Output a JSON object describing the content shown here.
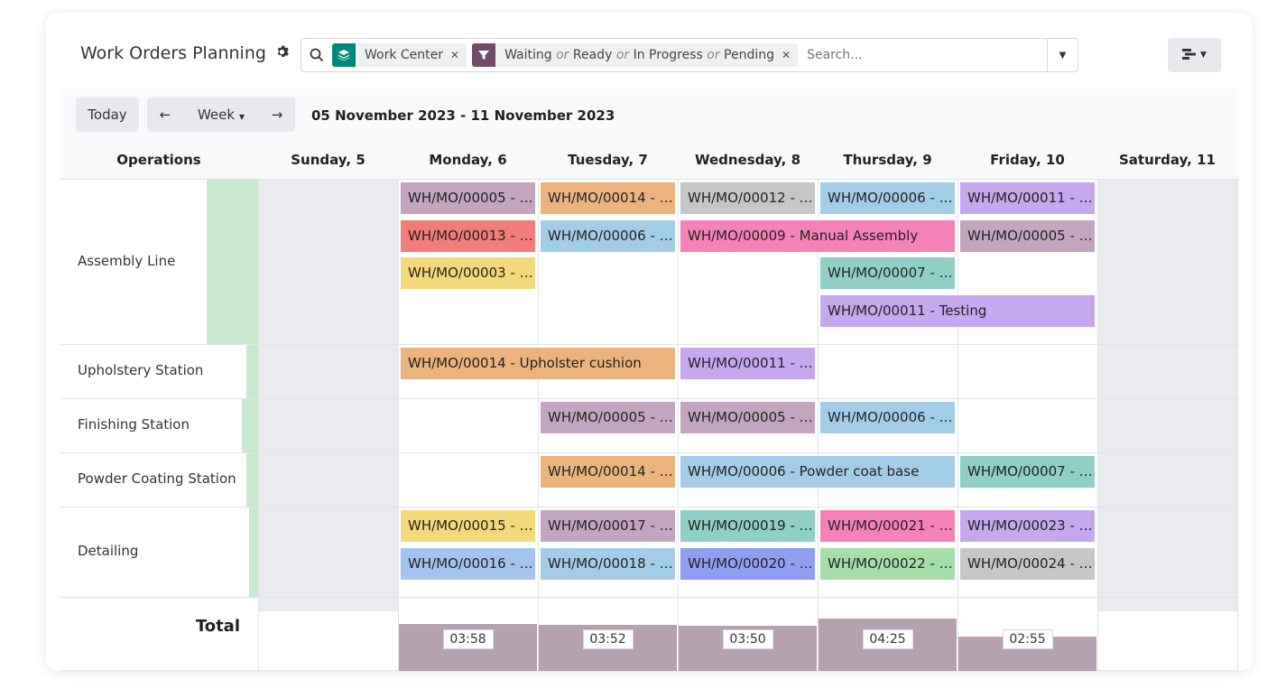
{
  "header": {
    "title": "Work Orders Planning",
    "facets": [
      {
        "icon": "layers-icon",
        "icon_color": "#00897b",
        "text_html": "Work Center"
      },
      {
        "icon": "filter-icon",
        "icon_color": "#714b67",
        "parts": [
          "Waiting",
          "or",
          "Ready",
          "or",
          "In Progress",
          "or",
          "Pending"
        ]
      }
    ],
    "search_placeholder": "Search..."
  },
  "nav": {
    "today": "Today",
    "prev": "←",
    "scale": "Week",
    "next": "→",
    "range": "05 November 2023 - 11 November 2023"
  },
  "columns": {
    "operations": "Operations",
    "days": [
      "Sunday, 5",
      "Monday, 6",
      "Tuesday, 7",
      "Wednesday, 8",
      "Thursday, 9",
      "Friday, 10",
      "Saturday, 11"
    ]
  },
  "rows": [
    "Assembly Line",
    "Upholstery Station",
    "Finishing Station",
    "Powder Coating Station",
    "Detailing"
  ],
  "pills": [
    {
      "text": "WH/MO/00005 - …",
      "row": 0,
      "lane": 0,
      "start": 1,
      "span": 1,
      "color": "#c4a5c0"
    },
    {
      "text": "WH/MO/00014 - …",
      "row": 0,
      "lane": 0,
      "start": 2,
      "span": 1,
      "color": "#ebb47e"
    },
    {
      "text": "WH/MO/00012 - …",
      "row": 0,
      "lane": 0,
      "start": 3,
      "span": 1,
      "color": "#c6c6c6"
    },
    {
      "text": "WH/MO/00006 - …",
      "row": 0,
      "lane": 0,
      "start": 4,
      "span": 1,
      "color": "#a3cce9"
    },
    {
      "text": "WH/MO/00011 - …",
      "row": 0,
      "lane": 0,
      "start": 5,
      "span": 1,
      "color": "#c5a8ee"
    },
    {
      "text": "WH/MO/00013 - …",
      "row": 0,
      "lane": 1,
      "start": 1,
      "span": 1,
      "color": "#f27c78"
    },
    {
      "text": "WH/MO/00006 - …",
      "row": 0,
      "lane": 1,
      "start": 2,
      "span": 1,
      "color": "#a3cce9"
    },
    {
      "text": "WH/MO/00009 - Manual Assembly",
      "row": 0,
      "lane": 1,
      "start": 3,
      "span": 2,
      "color": "#f481b8"
    },
    {
      "text": "WH/MO/00005 - …",
      "row": 0,
      "lane": 1,
      "start": 5,
      "span": 1,
      "color": "#c4a5c0"
    },
    {
      "text": "WH/MO/00003 - …",
      "row": 0,
      "lane": 2,
      "start": 1,
      "span": 1,
      "color": "#f3d97b"
    },
    {
      "text": "WH/MO/00007 - …",
      "row": 0,
      "lane": 2,
      "start": 4,
      "span": 1,
      "color": "#8fcfc5"
    },
    {
      "text": "WH/MO/00011 - Testing",
      "row": 0,
      "lane": 3,
      "start": 4,
      "span": 2,
      "color": "#c5a8ee"
    },
    {
      "text": "WH/MO/00014 - Upholster cushion",
      "row": 1,
      "lane": 0,
      "start": 1,
      "span": 2,
      "color": "#ebb47e"
    },
    {
      "text": "WH/MO/00011 - …",
      "row": 1,
      "lane": 0,
      "start": 3,
      "span": 1,
      "color": "#c5a8ee"
    },
    {
      "text": "WH/MO/00005 - …",
      "row": 2,
      "lane": 0,
      "start": 2,
      "span": 1,
      "color": "#c4a5c0"
    },
    {
      "text": "WH/MO/00005 - …",
      "row": 2,
      "lane": 0,
      "start": 3,
      "span": 1,
      "color": "#c4a5c0"
    },
    {
      "text": "WH/MO/00006 - …",
      "row": 2,
      "lane": 0,
      "start": 4,
      "span": 1,
      "color": "#a3cce9"
    },
    {
      "text": "WH/MO/00014 - …",
      "row": 3,
      "lane": 0,
      "start": 2,
      "span": 1,
      "color": "#ebb47e"
    },
    {
      "text": "WH/MO/00006 - Powder coat base",
      "row": 3,
      "lane": 0,
      "start": 3,
      "span": 2,
      "color": "#a3cce9"
    },
    {
      "text": "WH/MO/00007 - …",
      "row": 3,
      "lane": 0,
      "start": 5,
      "span": 1,
      "color": "#8fcfc5"
    },
    {
      "text": "WH/MO/00015 - …",
      "row": 4,
      "lane": 0,
      "start": 1,
      "span": 1,
      "color": "#f3d97b"
    },
    {
      "text": "WH/MO/00017 - …",
      "row": 4,
      "lane": 0,
      "start": 2,
      "span": 1,
      "color": "#c4a5c0"
    },
    {
      "text": "WH/MO/00019 - …",
      "row": 4,
      "lane": 0,
      "start": 3,
      "span": 1,
      "color": "#8fcfc5"
    },
    {
      "text": "WH/MO/00021 - …",
      "row": 4,
      "lane": 0,
      "start": 4,
      "span": 1,
      "color": "#f481b8"
    },
    {
      "text": "WH/MO/00023 - …",
      "row": 4,
      "lane": 0,
      "start": 5,
      "span": 1,
      "color": "#c5a8ee"
    },
    {
      "text": "WH/MO/00016 - …",
      "row": 4,
      "lane": 1,
      "start": 1,
      "span": 1,
      "color": "#a3c4ef"
    },
    {
      "text": "WH/MO/00018 - …",
      "row": 4,
      "lane": 1,
      "start": 2,
      "span": 1,
      "color": "#a3cce9"
    },
    {
      "text": "WH/MO/00020 - …",
      "row": 4,
      "lane": 1,
      "start": 3,
      "span": 1,
      "color": "#8f9ef0"
    },
    {
      "text": "WH/MO/00022 - …",
      "row": 4,
      "lane": 1,
      "start": 4,
      "span": 1,
      "color": "#a5dea8"
    },
    {
      "text": "WH/MO/00024 - …",
      "row": 4,
      "lane": 1,
      "start": 5,
      "span": 1,
      "color": "#c6c6c6"
    }
  ],
  "total": {
    "label": "Total",
    "values": [
      {
        "day": 1,
        "text": "03:58",
        "hours": 3.97
      },
      {
        "day": 2,
        "text": "03:52",
        "hours": 3.87
      },
      {
        "day": 3,
        "text": "03:50",
        "hours": 3.83
      },
      {
        "day": 4,
        "text": "04:25",
        "hours": 4.42
      },
      {
        "day": 5,
        "text": "02:55",
        "hours": 2.92
      }
    ]
  }
}
